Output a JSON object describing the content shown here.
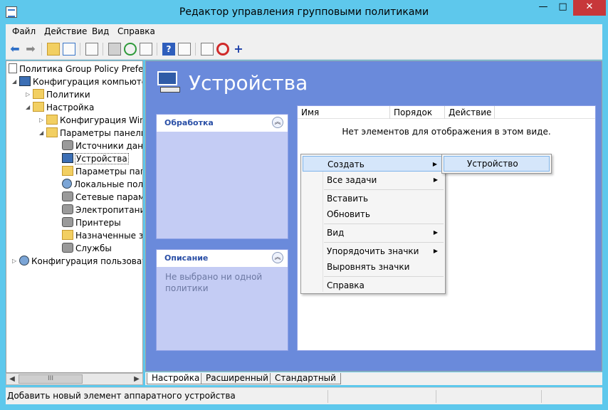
{
  "window": {
    "title": "Редактор управления групповыми политиками",
    "min": "—",
    "max": "□",
    "close": "✕"
  },
  "menubar": {
    "items": [
      "Файл",
      "Действие",
      "Вид",
      "Справка"
    ]
  },
  "tree": {
    "items": [
      {
        "label": "Политика Group Policy Prefere",
        "toggle": "",
        "icon": "doc"
      },
      {
        "label": "Конфигурация компьютер",
        "toggle": "◢",
        "icon": "pc"
      },
      {
        "label": "Политики",
        "toggle": "▷",
        "icon": "folder"
      },
      {
        "label": "Настройка",
        "toggle": "◢",
        "icon": "folder"
      },
      {
        "label": "Конфигурация Winc",
        "toggle": "▷",
        "icon": "folder"
      },
      {
        "label": "Параметры панели",
        "toggle": "◢",
        "icon": "folder"
      },
      {
        "label": "Источники данн",
        "toggle": "",
        "icon": "gear"
      },
      {
        "label": "Устройства",
        "toggle": "",
        "icon": "pc"
      },
      {
        "label": "Параметры папо",
        "toggle": "",
        "icon": "folder"
      },
      {
        "label": "Локальные поль",
        "toggle": "",
        "icon": "user"
      },
      {
        "label": "Сетевые параме",
        "toggle": "",
        "icon": "gear"
      },
      {
        "label": "Электропитание",
        "toggle": "",
        "icon": "gear"
      },
      {
        "label": "Принтеры",
        "toggle": "",
        "icon": "gear"
      },
      {
        "label": "Назначенные за",
        "toggle": "",
        "icon": "folder"
      },
      {
        "label": "Службы",
        "toggle": "",
        "icon": "gear"
      },
      {
        "label": "Конфигурация пользовате",
        "toggle": "▷",
        "icon": "user"
      }
    ],
    "scroll_thumb": "III"
  },
  "main": {
    "title": "Устройства",
    "panels": {
      "processing": {
        "title": "Обработка",
        "collapse": "︽"
      },
      "description": {
        "title": "Описание",
        "collapse": "︽",
        "text": "Не выбрано ни одной политики"
      }
    },
    "list": {
      "columns": [
        "Имя",
        "Порядок",
        "Действие"
      ],
      "empty_text": "Нет элементов для отображения в этом виде."
    }
  },
  "context_menu": {
    "items": [
      {
        "label": "Создать",
        "arrow": "▶"
      },
      {
        "label": "Все задачи",
        "arrow": "▶"
      },
      {
        "label": "Вставить",
        "arrow": ""
      },
      {
        "label": "Обновить",
        "arrow": ""
      },
      {
        "label": "Вид",
        "arrow": "▶"
      },
      {
        "label": "Упорядочить значки",
        "arrow": "▶"
      },
      {
        "label": "Выровнять значки",
        "arrow": ""
      },
      {
        "label": "Справка",
        "arrow": ""
      }
    ],
    "submenu": {
      "label": "Устройство"
    }
  },
  "tabs": [
    "Настройка",
    "Расширенный",
    "Стандартный"
  ],
  "status": {
    "text": "Добавить новый элемент аппаратного устройства"
  }
}
